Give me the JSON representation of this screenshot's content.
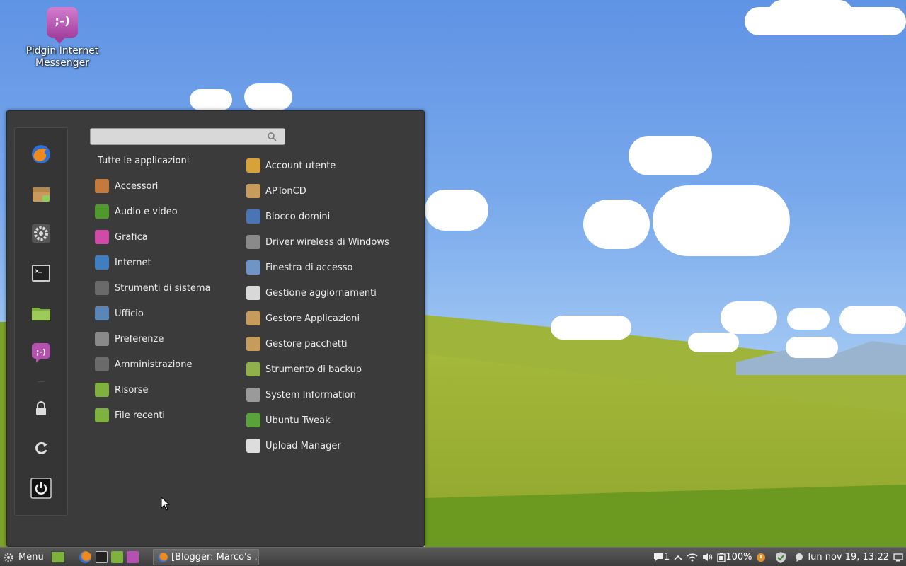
{
  "desktop": {
    "icon_label": "Pidgin Internet Messenger",
    "icon_glyph": ";-)"
  },
  "menu": {
    "search": {
      "value": "",
      "placeholder": ""
    },
    "all_apps_label": "Tutte le applicazioni",
    "favorites": [
      {
        "name": "firefox-icon"
      },
      {
        "name": "package-manager-icon"
      },
      {
        "name": "system-settings-icon"
      },
      {
        "name": "terminal-icon"
      },
      {
        "name": "folder-icon"
      },
      {
        "name": "pidgin-icon"
      }
    ],
    "session": [
      {
        "name": "lock-icon"
      },
      {
        "name": "logout-icon"
      },
      {
        "name": "power-icon"
      }
    ],
    "categories": [
      {
        "label": "Accessori",
        "icon": "accessories-icon",
        "color": "#c47a3d"
      },
      {
        "label": "Audio e video",
        "icon": "audio-video-icon",
        "color": "#4f9a2b"
      },
      {
        "label": "Grafica",
        "icon": "graphics-icon",
        "color": "#d04aa8"
      },
      {
        "label": "Internet",
        "icon": "internet-icon",
        "color": "#3f7fbf"
      },
      {
        "label": "Strumenti di sistema",
        "icon": "system-tools-icon",
        "color": "#6a6a6a"
      },
      {
        "label": "Ufficio",
        "icon": "office-icon",
        "color": "#5b86b8"
      },
      {
        "label": "Preferenze",
        "icon": "preferences-icon",
        "color": "#8a8a8a"
      },
      {
        "label": "Amministrazione",
        "icon": "administration-icon",
        "color": "#6a6a6a"
      },
      {
        "label": "Risorse",
        "icon": "places-icon",
        "color": "#7fb13f"
      },
      {
        "label": "File recenti",
        "icon": "recent-files-icon",
        "color": "#7fb13f"
      }
    ],
    "apps": [
      {
        "label": "Account utente",
        "icon": "user-accounts-icon",
        "color": "#d7a23a"
      },
      {
        "label": "APTonCD",
        "icon": "aptoncd-icon",
        "color": "#c79b5b"
      },
      {
        "label": "Blocco domini",
        "icon": "domain-block-icon",
        "color": "#4a74b4"
      },
      {
        "label": "Driver wireless di Windows",
        "icon": "wireless-driver-icon",
        "color": "#8a8a8a"
      },
      {
        "label": "Finestra di accesso",
        "icon": "login-window-icon",
        "color": "#6f95c7"
      },
      {
        "label": "Gestione aggiornamenti",
        "icon": "update-manager-icon",
        "color": "#d8d8d8"
      },
      {
        "label": "Gestore Applicazioni",
        "icon": "software-manager-icon",
        "color": "#c79b5b"
      },
      {
        "label": "Gestore pacchetti",
        "icon": "package-manager-icon",
        "color": "#c79b5b"
      },
      {
        "label": "Strumento di backup",
        "icon": "backup-tool-icon",
        "color": "#8fb04a"
      },
      {
        "label": "System Information",
        "icon": "system-info-icon",
        "color": "#9a9a9a"
      },
      {
        "label": "Ubuntu Tweak",
        "icon": "ubuntu-tweak-icon",
        "color": "#5aa33a"
      },
      {
        "label": "Upload Manager",
        "icon": "upload-manager-icon",
        "color": "#dddddd"
      }
    ]
  },
  "taskbar": {
    "menu_label": "Menu",
    "window_title": "[Blogger: Marco's ...",
    "notifications_count": "1",
    "battery": "100%",
    "clock": "lun nov 19, 13:22"
  }
}
